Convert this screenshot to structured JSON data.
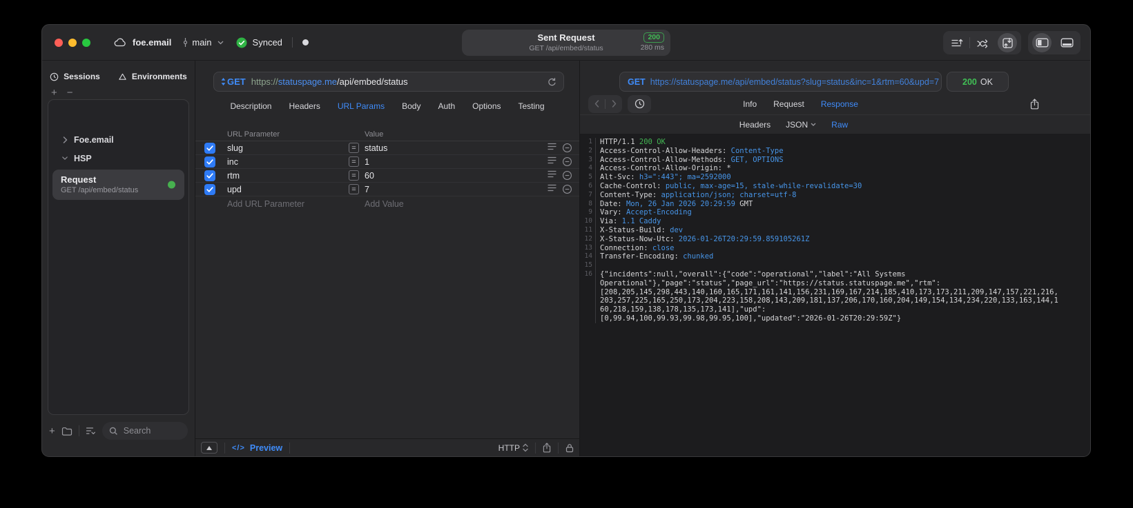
{
  "titlebar": {
    "project_name": "foe.email",
    "branch_name": "main",
    "sync_label": "Synced",
    "request_pill": {
      "title": "Sent Request",
      "subtitle": "GET /api/embed/status",
      "status_code": "200",
      "duration": "280 ms"
    }
  },
  "sidebar": {
    "tab_sessions": "Sessions",
    "tab_environments": "Environments",
    "group_foe": "Foe.email",
    "group_hsp": "HSP",
    "request_item_title": "Request",
    "request_item_subtitle": "GET /api/embed/status",
    "search_placeholder": "Search"
  },
  "request_pane": {
    "method": "GET",
    "url_scheme": "https://",
    "url_host": "statuspage.me",
    "url_path": "/api/embed/status",
    "tabs": [
      {
        "label": "Description"
      },
      {
        "label": "Headers"
      },
      {
        "label": "URL Params",
        "active": true
      },
      {
        "label": "Body"
      },
      {
        "label": "Auth"
      },
      {
        "label": "Options"
      },
      {
        "label": "Testing"
      }
    ],
    "table": {
      "col_param": "URL Parameter",
      "col_value": "Value",
      "rows": [
        {
          "name": "slug",
          "value": "status",
          "checked": true
        },
        {
          "name": "inc",
          "value": "1",
          "checked": true
        },
        {
          "name": "rtm",
          "value": "60",
          "checked": true
        },
        {
          "name": "upd",
          "value": "7",
          "checked": true
        }
      ],
      "add_param_label": "Add URL Parameter",
      "add_value_label": "Add Value"
    },
    "footer": {
      "code_glyph": "</>",
      "preview_label": "Preview",
      "protocol_label": "HTTP"
    }
  },
  "response_pane": {
    "method": "GET",
    "url": "https://statuspage.me/api/embed/status?slug=status&inc=1&rtm=60&upd=7",
    "status_code": "200",
    "status_text": "OK",
    "tabs": [
      {
        "label": "Info"
      },
      {
        "label": "Request"
      },
      {
        "label": "Response",
        "active": true
      }
    ],
    "subtabs": [
      {
        "label": "Headers"
      },
      {
        "label": "JSON",
        "chevron": true
      },
      {
        "label": "Raw",
        "active": true
      }
    ],
    "lines": [
      {
        "num": "1",
        "segments": [
          {
            "text": "HTTP/1.1 ",
            "color": "plain"
          },
          {
            "text": "200 OK",
            "color": "green"
          }
        ]
      },
      {
        "num": "2",
        "segments": [
          {
            "text": "Access-Control-Allow-Headers: ",
            "color": "plain"
          },
          {
            "text": "Content-Type",
            "color": "blue"
          }
        ]
      },
      {
        "num": "3",
        "segments": [
          {
            "text": "Access-Control-Allow-Methods: ",
            "color": "plain"
          },
          {
            "text": "GET, OPTIONS",
            "color": "blue"
          }
        ]
      },
      {
        "num": "4",
        "segments": [
          {
            "text": "Access-Control-Allow-Origin: ",
            "color": "plain"
          },
          {
            "text": "*",
            "color": "plain"
          }
        ]
      },
      {
        "num": "5",
        "segments": [
          {
            "text": "Alt-Svc: ",
            "color": "plain"
          },
          {
            "text": "h3=\":443\"; ma=2592000",
            "color": "blue"
          }
        ]
      },
      {
        "num": "6",
        "segments": [
          {
            "text": "Cache-Control: ",
            "color": "plain"
          },
          {
            "text": "public, max-age=15, stale-while-revalidate=30",
            "color": "blue"
          }
        ]
      },
      {
        "num": "7",
        "segments": [
          {
            "text": "Content-Type: ",
            "color": "plain"
          },
          {
            "text": "application/json; charset=utf-8",
            "color": "blue"
          }
        ]
      },
      {
        "num": "8",
        "segments": [
          {
            "text": "Date: ",
            "color": "plain"
          },
          {
            "text": "Mon, 26 Jan 2026 20:29:59",
            "color": "blue"
          },
          {
            "text": " GMT",
            "color": "plain"
          }
        ]
      },
      {
        "num": "9",
        "segments": [
          {
            "text": "Vary: ",
            "color": "plain"
          },
          {
            "text": "Accept-Encoding",
            "color": "blue"
          }
        ]
      },
      {
        "num": "10",
        "segments": [
          {
            "text": "Via: ",
            "color": "plain"
          },
          {
            "text": "1.1 Caddy",
            "color": "blue"
          }
        ]
      },
      {
        "num": "11",
        "segments": [
          {
            "text": "X-Status-Build: ",
            "color": "plain"
          },
          {
            "text": "dev",
            "color": "blue"
          }
        ]
      },
      {
        "num": "12",
        "segments": [
          {
            "text": "X-Status-Now-Utc: ",
            "color": "plain"
          },
          {
            "text": "2026-01-26T20:29:59.859105261Z",
            "color": "blue"
          }
        ]
      },
      {
        "num": "13",
        "segments": [
          {
            "text": "Connection: ",
            "color": "plain"
          },
          {
            "text": "close",
            "color": "blue"
          }
        ]
      },
      {
        "num": "14",
        "segments": [
          {
            "text": "Transfer-Encoding: ",
            "color": "plain"
          },
          {
            "text": "chunked",
            "color": "blue"
          }
        ]
      },
      {
        "num": "15",
        "segments": []
      },
      {
        "num": "16",
        "segments": [
          {
            "text": "{\"incidents\":null,\"overall\":{\"code\":\"operational\",\"label\":\"All Systems",
            "color": "plain"
          }
        ]
      },
      {
        "num": "",
        "segments": [
          {
            "text": "Operational\"},\"page\":\"status\",\"page_url\":\"https://status.statuspage.me\",\"rtm\":",
            "color": "plain"
          }
        ]
      },
      {
        "num": "",
        "segments": [
          {
            "text": "[208,205,145,298,443,140,160,165,171,161,141,156,231,169,167,214,185,410,173,173,211,209,147,157,221,216,",
            "color": "plain"
          }
        ]
      },
      {
        "num": "",
        "segments": [
          {
            "text": "203,257,225,165,250,173,204,223,158,208,143,209,181,137,206,170,160,204,149,154,134,234,220,133,163,144,1",
            "color": "plain"
          }
        ]
      },
      {
        "num": "",
        "segments": [
          {
            "text": "60,218,159,138,178,135,173,141],\"upd\":",
            "color": "plain"
          }
        ]
      },
      {
        "num": "",
        "segments": [
          {
            "text": "[0,99.94,100,99.93,99.98,99.95,100],\"updated\":\"2026-01-26T20:29:59Z\"}",
            "color": "plain"
          }
        ]
      }
    ]
  },
  "colors": {
    "accent_blue": "#3f8cfa",
    "value_blue": "#4795e8",
    "status_green": "#41b64b",
    "traffic_red": "#ff5f57",
    "traffic_yellow": "#febc2e",
    "traffic_green": "#28c840"
  }
}
